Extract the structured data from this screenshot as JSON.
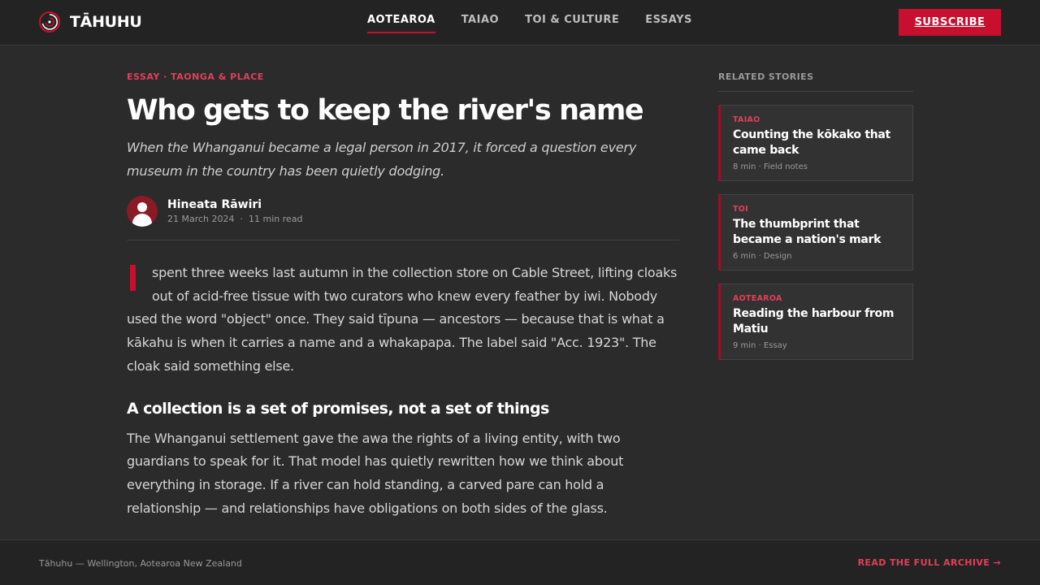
{
  "header": {
    "brand": "TĀHUHU",
    "nav": [
      {
        "label": "AOTEAROA",
        "active": true
      },
      {
        "label": "TAIAO",
        "active": false
      },
      {
        "label": "TOI & CULTURE",
        "active": false
      },
      {
        "label": "ESSAYS",
        "active": false
      }
    ],
    "subscribe_label": "SUBSCRIBE"
  },
  "colors": {
    "accent": "#c8102e",
    "accent_text": "#e0405a",
    "background": "#2b2b2b",
    "bar": "#232323"
  },
  "icons": {
    "logo": "spiral-logo-icon",
    "avatar": "person-icon"
  },
  "article": {
    "kicker": "ESSAY · TAONGA & PLACE",
    "headline": "Who gets to keep the river's name",
    "standfirst": "When the Whanganui became a legal person in 2017, it forced a question every museum in the country has been quietly dodging.",
    "author": "Hineata Rāwiri",
    "date": "21 March 2024",
    "read_time": "11 min read",
    "paragraph_1": "spent three weeks last autumn in the collection store on Cable Street, lifting cloaks out of acid-free tissue with two curators who knew every feather by iwi. Nobody used the word \"object\" once. They said tīpuna — ancestors — because that is what a kākahu is when it carries a name and a whakapapa. The label said \"Acc. 1923\". The cloak said something else.",
    "subheading": "A collection is a set of promises, not a set of things",
    "paragraph_2": "The Whanganui settlement gave the awa the rights of a living entity, with two guardians to speak for it. That model has quietly rewritten how we think about everything in storage. If a river can hold standing, a carved pare can hold a relationship — and relationships have obligations on both sides of the glass."
  },
  "sidebar": {
    "title": "RELATED STORIES",
    "cards": [
      {
        "tag": "TAIAO",
        "title": "Counting the kōkako that came back",
        "meta": "8 min · Field notes"
      },
      {
        "tag": "TOI",
        "title": "The thumbprint that became a nation's mark",
        "meta": "6 min · Design"
      },
      {
        "tag": "AOTEAROA",
        "title": "Reading the harbour from Matiu",
        "meta": "9 min · Essay"
      }
    ]
  },
  "footer": {
    "left": "Tāhuhu — Wellington, Aotearoa New Zealand",
    "right": "READ THE FULL ARCHIVE →"
  }
}
